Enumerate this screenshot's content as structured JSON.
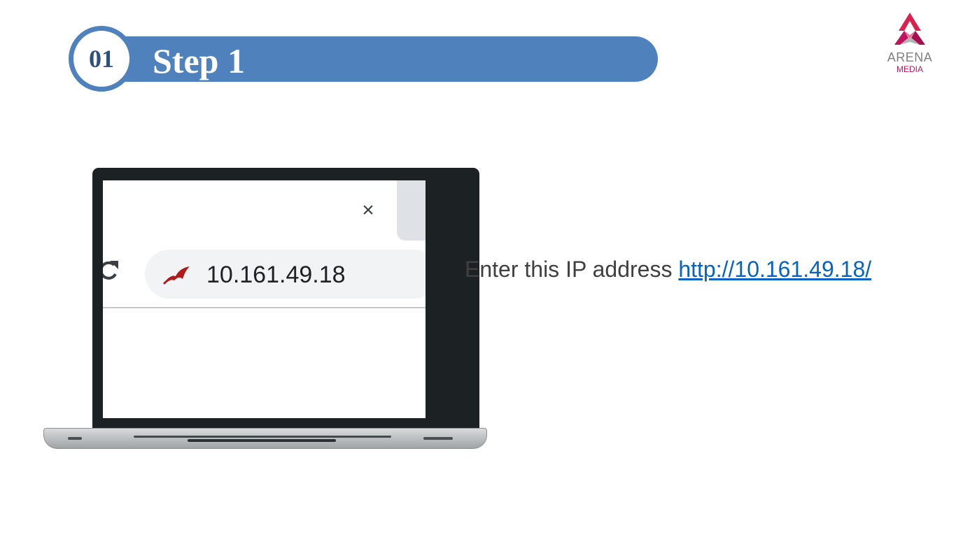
{
  "header": {
    "step_number": "01",
    "step_title": "Step 1"
  },
  "logo": {
    "brand": "ARENA",
    "sub": "MEDIA",
    "icon": "arena-media-logo"
  },
  "browser": {
    "close_icon": "close-icon",
    "close_glyph": "×",
    "reload_icon": "reload-icon",
    "site_icon": "site-favicon-icon",
    "address": "10.161.49.18"
  },
  "instruction": {
    "text": "Enter this IP address ",
    "link": "http://10.161.49.18/"
  },
  "colors": {
    "banner": "#4f81bd",
    "link": "#0563c1",
    "logo_accent": "#c0155c"
  }
}
